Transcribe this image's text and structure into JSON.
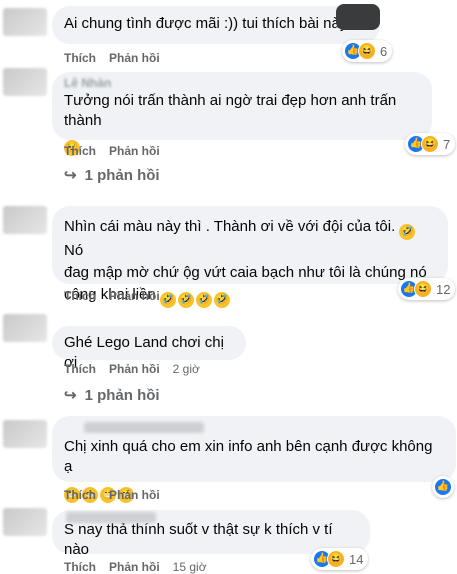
{
  "comments": [
    {
      "text": "Ai chung tình được mãi :)) tui thích bài này",
      "like_label": "Thích",
      "reply_label": "Phản hồi",
      "reaction_count": "6"
    },
    {
      "author": "Lê Nhàn",
      "text": "Tưởng nói trấn thành ai ngờ trai đẹp hơn anh trấn thành",
      "like_label": "Thích",
      "reply_label": "Phản hồi",
      "reaction_count": "7",
      "replies_label": "1 phản hồi"
    },
    {
      "text_line1": "Nhìn cái màu này thì . Thành ơi về với đội của tôi.",
      "text_line1b": "Nó",
      "text_line2": "đag mập mờ chứ ộg vứt caia bạch như tôi là chúng nó",
      "text_line3": "công khai liền",
      "like_label": "Thích",
      "reply_label": "Phản hồi",
      "reaction_count": "12"
    },
    {
      "text": "Ghé Lego Land chơi chị ơi",
      "like_label": "Thích",
      "reply_label": "Phản hồi",
      "time": "2 giờ",
      "replies_label": "1 phản hồi"
    },
    {
      "text": "Chị xinh quá cho em xin info anh bên cạnh được không ạ",
      "like_label": "Thích",
      "reply_label": "Phản hồi"
    },
    {
      "text": "S nay thả thính suốt v thật sự k thích v tí nào",
      "like_label": "Thích",
      "reply_label": "Phản hồi",
      "time": "15 giờ",
      "reaction_count": "14"
    }
  ],
  "icons": {
    "like": "like-icon",
    "haha": "haha-icon",
    "laugh_cry": "laugh-cry-emoji",
    "smile": "smile-emoji",
    "reply_arrow": "reply-arrow-icon"
  },
  "colors": {
    "bubble": "#f0f2f5",
    "meta": "#65676b",
    "like": "#1877f2",
    "haha": "#f7b125"
  }
}
